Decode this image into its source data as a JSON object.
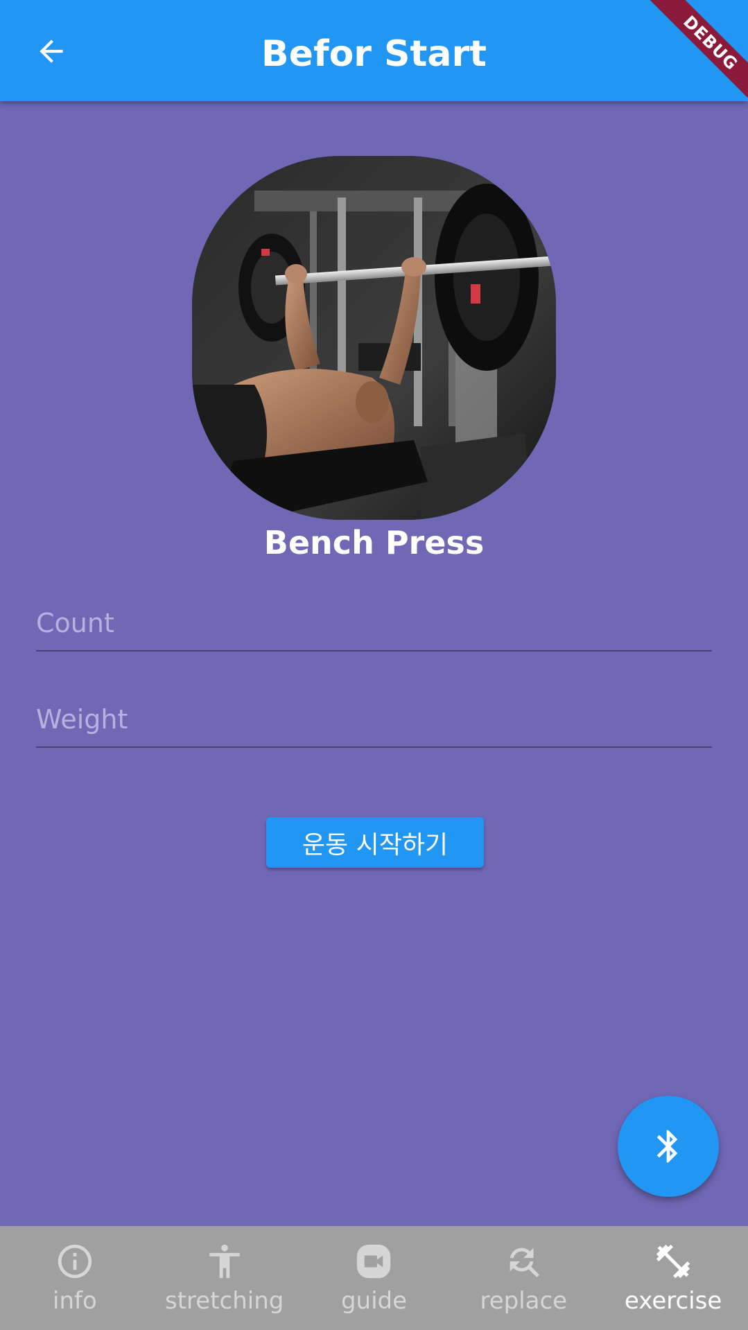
{
  "appbar": {
    "title": "Befor Start",
    "back_icon": "arrow-back-icon",
    "color": "#2196f3"
  },
  "debug_banner": "DEBUG",
  "exercise": {
    "name": "Bench Press",
    "image": "bench-press-photo"
  },
  "form": {
    "count_placeholder": "Count",
    "weight_placeholder": "Weight"
  },
  "start_button": {
    "label": "운동 시작하기"
  },
  "fab": {
    "icon": "bluetooth-icon"
  },
  "bottom_nav": {
    "items": [
      {
        "label": "info",
        "icon": "info-icon"
      },
      {
        "label": "stretching",
        "icon": "accessibility-icon"
      },
      {
        "label": "guide",
        "icon": "video-icon"
      },
      {
        "label": "replace",
        "icon": "find-replace-icon"
      },
      {
        "label": "exercise",
        "icon": "fitness-center-icon"
      }
    ],
    "active": "exercise"
  },
  "colors": {
    "background": "#7068b5",
    "primary": "#2196f3",
    "nav_background": "#a0a0a0",
    "debug": "#8b1a3a"
  }
}
